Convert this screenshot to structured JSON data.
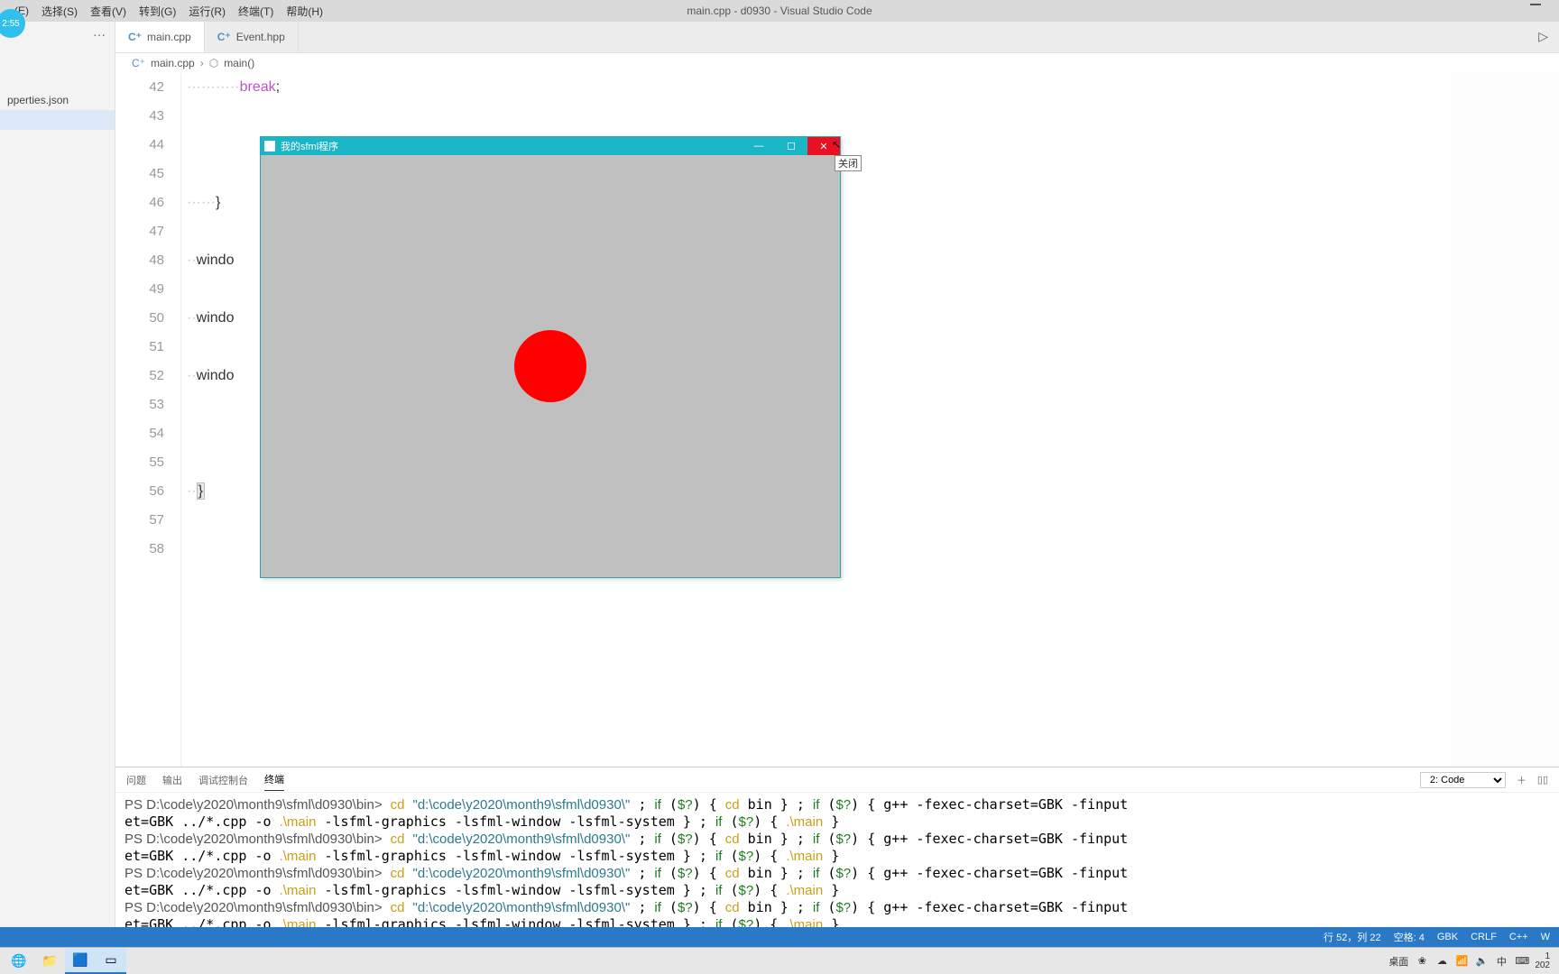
{
  "badge": {
    "time": "2:55"
  },
  "menu": {
    "items": [
      "(E)",
      "选择(S)",
      "查看(V)",
      "转到(G)",
      "运行(R)",
      "终端(T)",
      "帮助(H)"
    ],
    "windowTitle": "main.cpp - d0930 - Visual Studio Code"
  },
  "sidebar": {
    "more": "···",
    "file1": "pperties.json"
  },
  "tabs": {
    "items": [
      {
        "icon": "C⁺",
        "label": "main.cpp",
        "active": true
      },
      {
        "icon": "C⁺",
        "label": "Event.hpp",
        "active": false
      }
    ],
    "runGlyph": "▷"
  },
  "breadcrumb": {
    "parts": [
      "main.cpp",
      "main()"
    ],
    "iconA": "C⁺",
    "iconB": "⬡"
  },
  "code": {
    "startLine": 42,
    "endLine": 58,
    "lines": {
      "42": {
        "indent": 11,
        "text": "break;",
        "kw": "break"
      },
      "43": {
        "indent": 0,
        "text": ""
      },
      "44": {
        "indent": 0,
        "text": ""
      },
      "45": {
        "indent": 0,
        "text": ""
      },
      "46": {
        "indent": 6,
        "text": "}"
      },
      "47": {
        "indent": 0,
        "text": ""
      },
      "48": {
        "indent": 2,
        "text": "windo"
      },
      "49": {
        "indent": 0,
        "text": ""
      },
      "50": {
        "indent": 2,
        "text": "windo"
      },
      "51": {
        "indent": 0,
        "text": ""
      },
      "52": {
        "indent": 2,
        "text": "windo"
      },
      "53": {
        "indent": 0,
        "text": ""
      },
      "54": {
        "indent": 0,
        "text": ""
      },
      "55": {
        "indent": 0,
        "text": ""
      },
      "56": {
        "indent": 2,
        "text": "}",
        "hl": true
      },
      "57": {
        "indent": 0,
        "text": ""
      },
      "58": {
        "indent": 0,
        "text": ""
      }
    }
  },
  "panel": {
    "tabs": [
      "问题",
      "输出",
      "调试控制台",
      "终端"
    ],
    "activeTab": 3,
    "shellSelector": "2: Code",
    "addGlyph": "＋",
    "splitGlyph": "▯▯",
    "terminalRaw": "PS D:\\code\\y2020\\month9\\sfml\\d0930\\bin> cd \"d:\\code\\y2020\\month9\\sfml\\d0930\\\" ; if ($?) { cd bin } ; if ($?) { g++ -fexec-charset=GBK -finput\net=GBK ../*.cpp -o .\\main -lsfml-graphics -lsfml-window -lsfml-system } ; if ($?) { .\\main }\nPS D:\\code\\y2020\\month9\\sfml\\d0930\\bin> cd \"d:\\code\\y2020\\month9\\sfml\\d0930\\\" ; if ($?) { cd bin } ; if ($?) { g++ -fexec-charset=GBK -finput\net=GBK ../*.cpp -o .\\main -lsfml-graphics -lsfml-window -lsfml-system } ; if ($?) { .\\main }\nPS D:\\code\\y2020\\month9\\sfml\\d0930\\bin> cd \"d:\\code\\y2020\\month9\\sfml\\d0930\\\" ; if ($?) { cd bin } ; if ($?) { g++ -fexec-charset=GBK -finput\net=GBK ../*.cpp -o .\\main -lsfml-graphics -lsfml-window -lsfml-system } ; if ($?) { .\\main }\nPS D:\\code\\y2020\\month9\\sfml\\d0930\\bin> cd \"d:\\code\\y2020\\month9\\sfml\\d0930\\\" ; if ($?) { cd bin } ; if ($?) { g++ -fexec-charset=GBK -finput\net=GBK ../*.cpp -o .\\main -lsfml-graphics -lsfml-window -lsfml-system } ; if ($?) { .\\main }\n"
  },
  "statusbar": {
    "cursor": "行 52，列 22",
    "spaces": "空格: 4",
    "encoding": "GBK",
    "eol": "CRLF",
    "lang": "C++",
    "extra": "W"
  },
  "sfml": {
    "title": "我的sfml程序",
    "minGlyph": "—",
    "maxGlyph": "☐",
    "closeGlyph": "✕",
    "tooltip": "关闭"
  },
  "taskbar": {
    "icons": [
      "🌐",
      "📁",
      "🟦",
      "▭"
    ],
    "trayLabel": "桌面",
    "trayIcons": [
      "❀",
      "☁",
      "📶",
      "🔈",
      "中",
      "⌨"
    ],
    "time1": "1",
    "time2": "202"
  }
}
